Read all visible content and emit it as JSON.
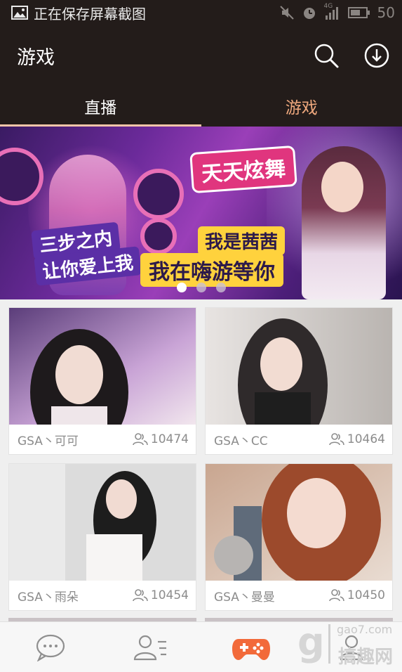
{
  "status_bar": {
    "notification": "正在保存屏幕截图",
    "signal_label": "4G",
    "battery": "50",
    "icons": [
      "image-icon",
      "mute-icon",
      "alarm-icon",
      "signal-icon",
      "battery-icon"
    ]
  },
  "app_bar": {
    "title": "游戏",
    "icons": [
      "search-icon",
      "download-icon"
    ]
  },
  "tabs": [
    {
      "label": "直播",
      "active": true
    },
    {
      "label": "游戏",
      "active": false
    }
  ],
  "banner": {
    "logo": "天天炫舞",
    "line1": "三步之内",
    "line2": "让你爱上我",
    "line3": "我是茜茜",
    "line4": "我在嗨游等你",
    "page_count": 3,
    "active_index": 0
  },
  "streams": [
    {
      "name": "GSA丶可可",
      "viewers": "10474",
      "thumb_colors": [
        "#5b3d7a",
        "#c9a4d6",
        "#f2e7ee"
      ]
    },
    {
      "name": "GSA丶CC",
      "viewers": "10464",
      "thumb_colors": [
        "#e8e4e2",
        "#b9b4b0",
        "#2f2a2b"
      ]
    },
    {
      "name": "GSA丶雨朵",
      "viewers": "10454",
      "thumb_colors": [
        "#d8d8d8",
        "#eaeaea",
        "#1d1d1d"
      ]
    },
    {
      "name": "GSA丶曼曼",
      "viewers": "10450",
      "thumb_colors": [
        "#c9a690",
        "#9c4a2c",
        "#5f6b7a"
      ]
    }
  ],
  "bottom_nav": [
    {
      "icon": "chat-icon",
      "active": false
    },
    {
      "icon": "contacts-icon",
      "active": false
    },
    {
      "icon": "gamepad-icon",
      "active": true
    },
    {
      "icon": "profile-icon",
      "active": false
    }
  ],
  "watermark": {
    "url": "gao7.com",
    "text": "搞趣网"
  },
  "colors": {
    "bar_bg": "#231c1a",
    "accent": "#f26a3a",
    "inactive_tab": "#f0a97e",
    "meta_text": "#8c8c8c"
  }
}
